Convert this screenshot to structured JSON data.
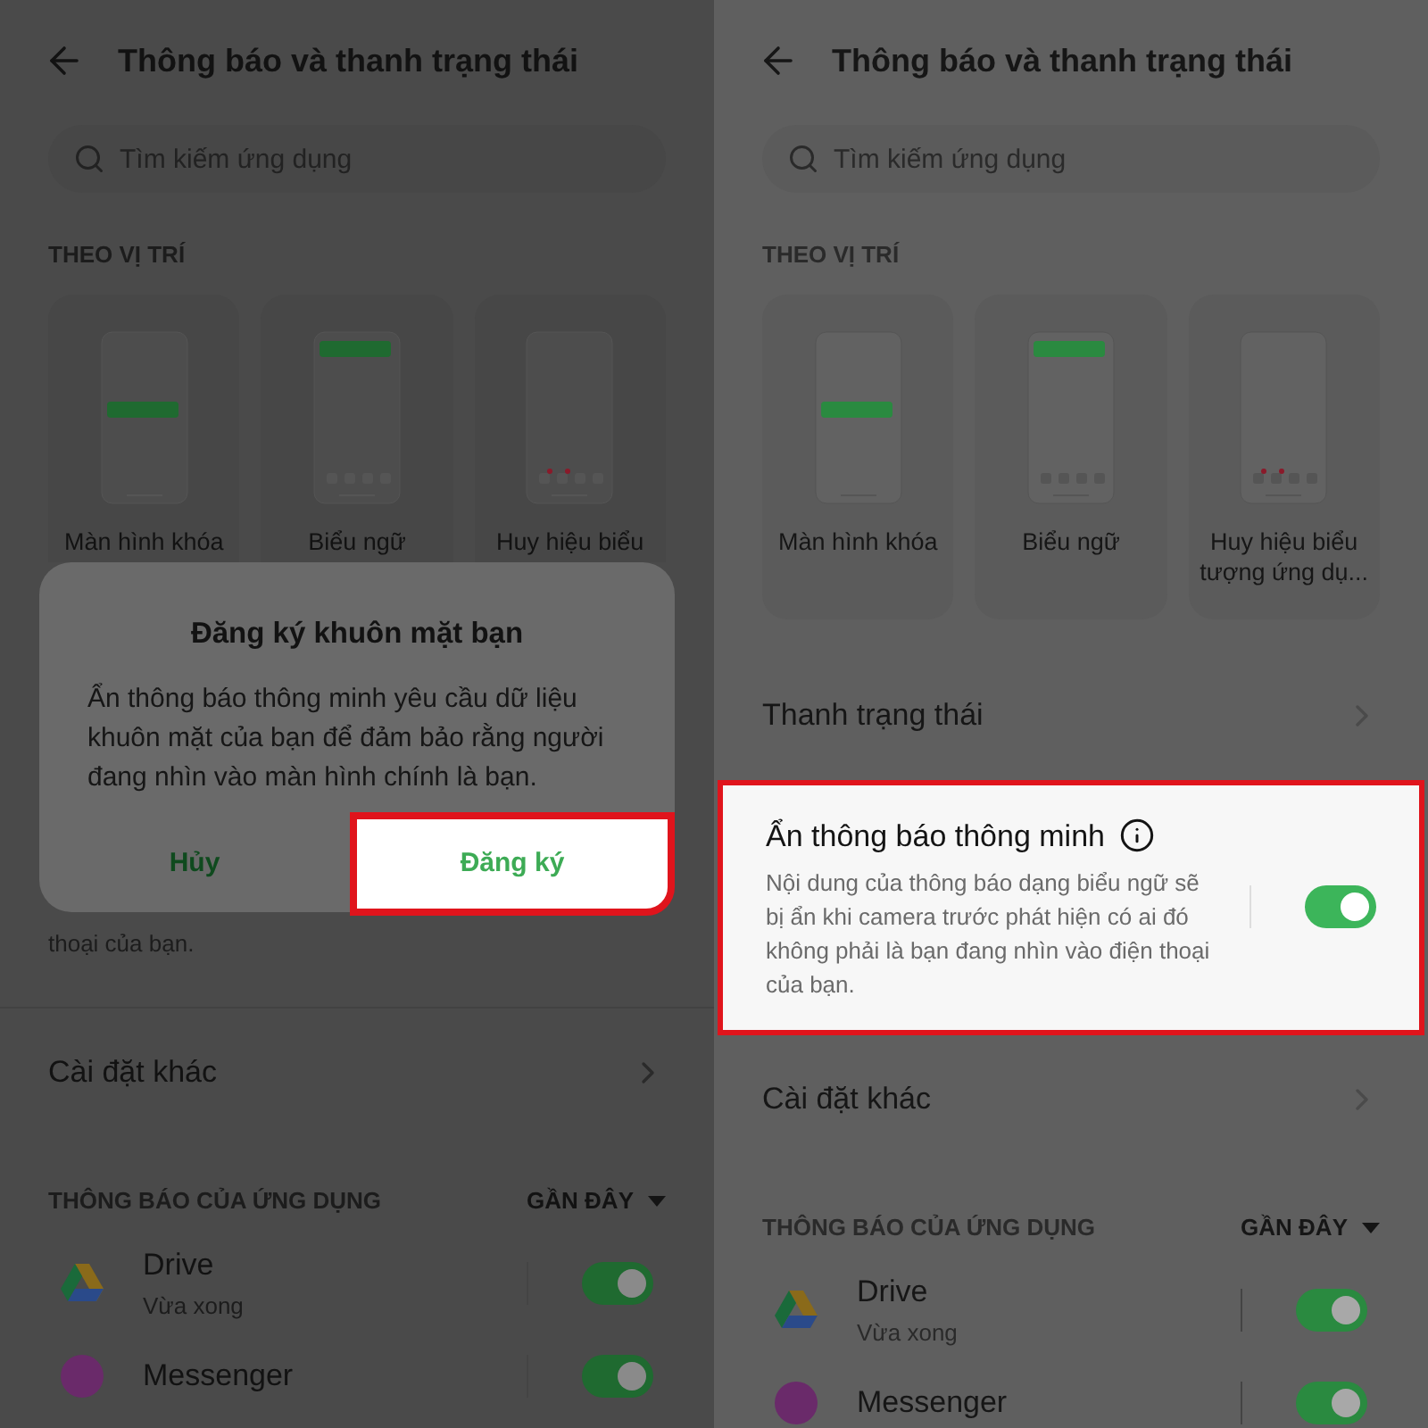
{
  "panels": [
    {
      "header": {
        "title": "Thông báo và thanh trạng thái"
      },
      "search": {
        "placeholder": "Tìm kiếm ứng dụng"
      },
      "section": "THEO VỊ TRÍ",
      "styles": [
        {
          "kind": "lockscreen",
          "label": "Màn hình khóa"
        },
        {
          "kind": "banner",
          "label": "Biểu ngữ"
        },
        {
          "kind": "badge",
          "label": "Huy hiệu biểu"
        }
      ],
      "dialog": {
        "title": "Đăng ký khuôn mặt bạn",
        "message": "Ẩn thông báo thông minh yêu cầu dữ liệu khuôn mặt của bạn để đảm bảo rằng người đang nhìn vào màn hình chính là bạn.",
        "buttons": [
          {
            "label": "Hủy",
            "highlighted": false
          },
          {
            "label": "Đăng ký",
            "highlighted": true
          }
        ]
      },
      "items": [
        {
          "kind": "text",
          "text": "thoại của bạn."
        },
        {
          "kind": "link",
          "label": "Cài đặt khác"
        }
      ],
      "apps_header": {
        "label": "THÔNG BÁO CỦA ỨNG DỤNG",
        "sort": "GẦN ĐÂY"
      },
      "apps": [
        {
          "kind": "drive",
          "name": "Drive",
          "time": "Vừa xong",
          "on": true
        },
        {
          "kind": "messenger",
          "name": "Messenger",
          "on": true
        }
      ]
    },
    {
      "header": {
        "title": "Thông báo và thanh trạng thái"
      },
      "search": {
        "placeholder": "Tìm kiếm ứng dụng"
      },
      "section": "THEO VỊ TRÍ",
      "styles": [
        {
          "kind": "lockscreen",
          "label": "Màn hình khóa"
        },
        {
          "kind": "banner",
          "label": "Biểu ngữ"
        },
        {
          "kind": "badge",
          "label": "Huy hiệu biểu tượng ứng dụ..."
        }
      ],
      "items": [
        {
          "kind": "link",
          "label": "Thanh trạng thái"
        },
        {
          "kind": "toggle",
          "label": "Ẩn thông báo thông minh",
          "description": "Nội dung của thông báo dạng biểu ngữ sẽ bị ẩn khi camera trước phát hiện có ai đó không phải là bạn đang nhìn vào điện thoại của bạn.",
          "on": true,
          "highlighted": true
        },
        {
          "kind": "link",
          "label": "Cài đặt khác"
        }
      ],
      "apps_header": {
        "label": "THÔNG BÁO CỦA ỨNG DỤNG",
        "sort": "GẦN ĐÂY"
      },
      "apps": [
        {
          "kind": "drive",
          "name": "Drive",
          "time": "Vừa xong",
          "on": true
        },
        {
          "kind": "messenger",
          "name": "Messenger",
          "on": true
        }
      ]
    }
  ]
}
